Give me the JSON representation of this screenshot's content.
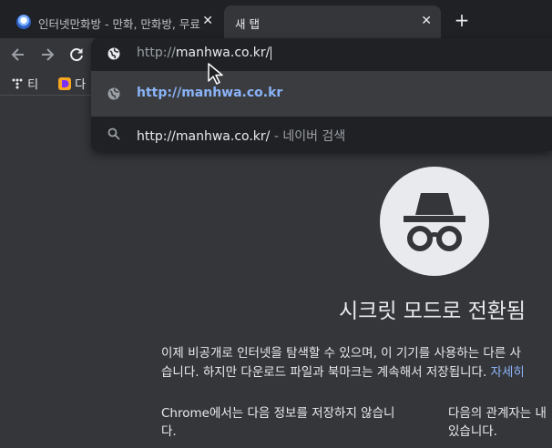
{
  "tabs": [
    {
      "title": "인터넷만화방 - 만화, 만화방, 무료",
      "close": "✕"
    },
    {
      "title": "새 탭",
      "close": "✕"
    }
  ],
  "new_tab": "+",
  "bookmarks": [
    {
      "label": "티"
    },
    {
      "label": "다"
    }
  ],
  "omnibox": {
    "scheme": "http://",
    "host": "manhwa.co.kr/",
    "suggestion_url": "http://manhwa.co.kr",
    "search_query": "http://manhwa.co.kr/",
    "search_suffix": " - 네이버 검색"
  },
  "incognito": {
    "heading": "시크릿 모드로 전환됨",
    "intro_line1": "이제 비공개로 인터넷을 탐색할 수 있으며, 이 기기를 사용하는 다른 사",
    "intro_line2": "습니다. 하지만 다운로드 파일과 북마크는 계속해서 저장됩니다. ",
    "intro_link": "자세히",
    "col_a_line1": "Chrome에서는 다음 정보를 저장하지 않습니",
    "col_a_line2": "다.",
    "col_b_line1": "다음의 관계자는 내",
    "col_b_line2": "있습니다."
  },
  "colors": {
    "background": "#35363a",
    "tabstrip": "#202124",
    "link": "#8ab4f8"
  }
}
